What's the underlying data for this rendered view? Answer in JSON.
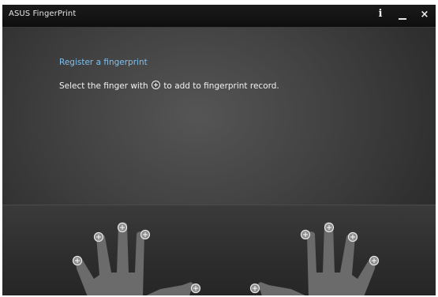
{
  "window": {
    "title": "ASUS FingerPrint",
    "controls": {
      "info": "i",
      "minimize": "minimize",
      "close": "×"
    }
  },
  "main": {
    "heading": "Register a fingerprint",
    "instruction_before": "Select the finger with",
    "instruction_icon": "plus-circle-icon",
    "instruction_after": "to add to fingerprint record."
  },
  "hands": {
    "left": [
      "pinky",
      "ring",
      "middle",
      "index",
      "thumb"
    ],
    "right": [
      "thumb",
      "index",
      "middle",
      "ring",
      "pinky"
    ],
    "add_icon": "plus-circle-icon"
  },
  "colors": {
    "heading": "#7fc1ef",
    "hand": "#6b6b6b",
    "background": "#3a3a3a"
  }
}
